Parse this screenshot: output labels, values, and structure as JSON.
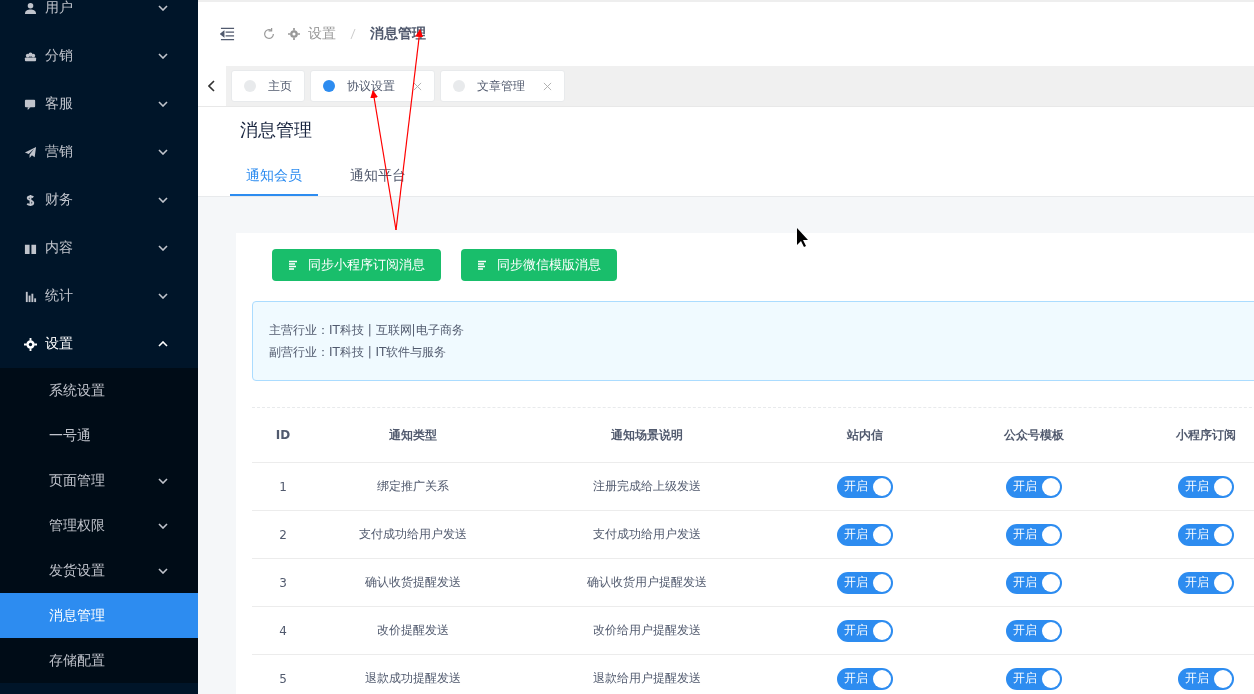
{
  "sidebar": {
    "items": [
      {
        "label": "用户",
        "expanded": false
      },
      {
        "label": "分销",
        "expanded": false
      },
      {
        "label": "客服",
        "expanded": false
      },
      {
        "label": "营销",
        "expanded": false
      },
      {
        "label": "财务",
        "expanded": false
      },
      {
        "label": "内容",
        "expanded": false
      },
      {
        "label": "统计",
        "expanded": false
      },
      {
        "label": "设置",
        "expanded": true,
        "children": [
          {
            "label": "系统设置",
            "kind": "item",
            "selected": false
          },
          {
            "label": "一号通",
            "kind": "item",
            "selected": false
          },
          {
            "label": "页面管理",
            "kind": "submenu",
            "expanded": false,
            "selected": false
          },
          {
            "label": "管理权限",
            "kind": "submenu",
            "expanded": false,
            "selected": false
          },
          {
            "label": "发货设置",
            "kind": "submenu",
            "expanded": false,
            "selected": false
          },
          {
            "label": "消息管理",
            "kind": "item",
            "selected": true
          },
          {
            "label": "存储配置",
            "kind": "item",
            "selected": false
          }
        ]
      }
    ]
  },
  "breadcrumb": [
    "设置",
    "消息管理"
  ],
  "page_tabs": [
    {
      "label": "主页",
      "selected": false,
      "closable": false
    },
    {
      "label": "协议设置",
      "selected": true,
      "closable": true
    },
    {
      "label": "文章管理",
      "selected": false,
      "closable": true
    }
  ],
  "page": {
    "title": "消息管理",
    "tabs": [
      {
        "label": "通知会员",
        "selected": true
      },
      {
        "label": "通知平台",
        "selected": false
      }
    ],
    "buttons": [
      "同步小程序订阅消息",
      "同步微信模版消息"
    ],
    "alert": [
      "主营行业：IT科技 | 互联网|电子商务",
      "副营行业：IT科技 | IT软件与服务"
    ],
    "table": {
      "columns": [
        "ID",
        "通知类型",
        "通知场景说明",
        "站内信",
        "公众号模板",
        "小程序订阅"
      ],
      "rows": [
        {
          "id": "1",
          "type": "绑定推广关系",
          "desc": "注册完成给上级发送",
          "switches": [
            {
              "label": "开启",
              "on": true
            },
            {
              "label": "开启",
              "on": true
            },
            {
              "label": "开启",
              "on": true
            }
          ]
        },
        {
          "id": "2",
          "type": "支付成功给用户发送",
          "desc": "支付成功给用户发送",
          "switches": [
            {
              "label": "开启",
              "on": true
            },
            {
              "label": "开启",
              "on": true
            },
            {
              "label": "开启",
              "on": true
            }
          ]
        },
        {
          "id": "3",
          "type": "确认收货提醒发送",
          "desc": "确认收货用户提醒发送",
          "switches": [
            {
              "label": "开启",
              "on": true
            },
            {
              "label": "开启",
              "on": true
            },
            {
              "label": "开启",
              "on": true
            }
          ]
        },
        {
          "id": "4",
          "type": "改价提醒发送",
          "desc": "改价给用户提醒发送",
          "switches": [
            {
              "label": "开启",
              "on": true
            },
            {
              "label": "开启",
              "on": true
            }
          ]
        },
        {
          "id": "5",
          "type": "退款成功提醒发送",
          "desc": "退款给用户提醒发送",
          "switches": [
            {
              "label": "开启",
              "on": true
            },
            {
              "label": "开启",
              "on": true
            },
            {
              "label": "开启",
              "on": true
            }
          ]
        }
      ]
    }
  }
}
